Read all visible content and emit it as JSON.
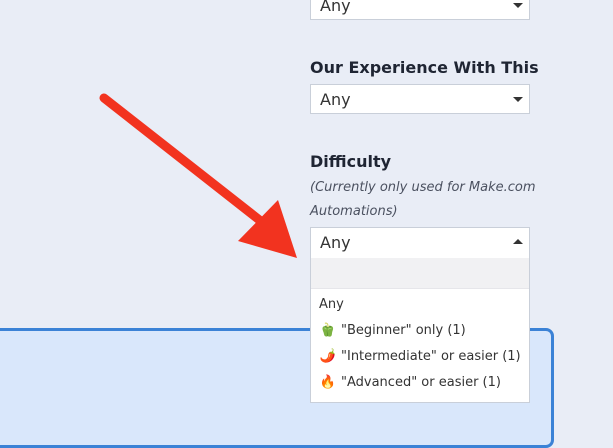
{
  "filters": {
    "top_select": {
      "value": "Any"
    },
    "experience": {
      "title": "Our Experience With This",
      "value": "Any"
    },
    "difficulty": {
      "title": "Difficulty",
      "note_line1": "(Currently only used for Make.com",
      "note_line2": "Automations)",
      "value": "Any",
      "options": [
        {
          "label": "Any",
          "icon": ""
        },
        {
          "label": "\"Beginner\" only (1)",
          "icon": "🫑"
        },
        {
          "label": "\"Intermediate\" or easier (1)",
          "icon": "🌶️"
        },
        {
          "label": "\"Advanced\" or easier (1)",
          "icon": "🔥"
        }
      ]
    }
  },
  "colors": {
    "page_bg": "#e9edf6",
    "arrow": "#f2331f",
    "card_border": "#3b82d6",
    "card_bg": "#d9e7fb"
  }
}
